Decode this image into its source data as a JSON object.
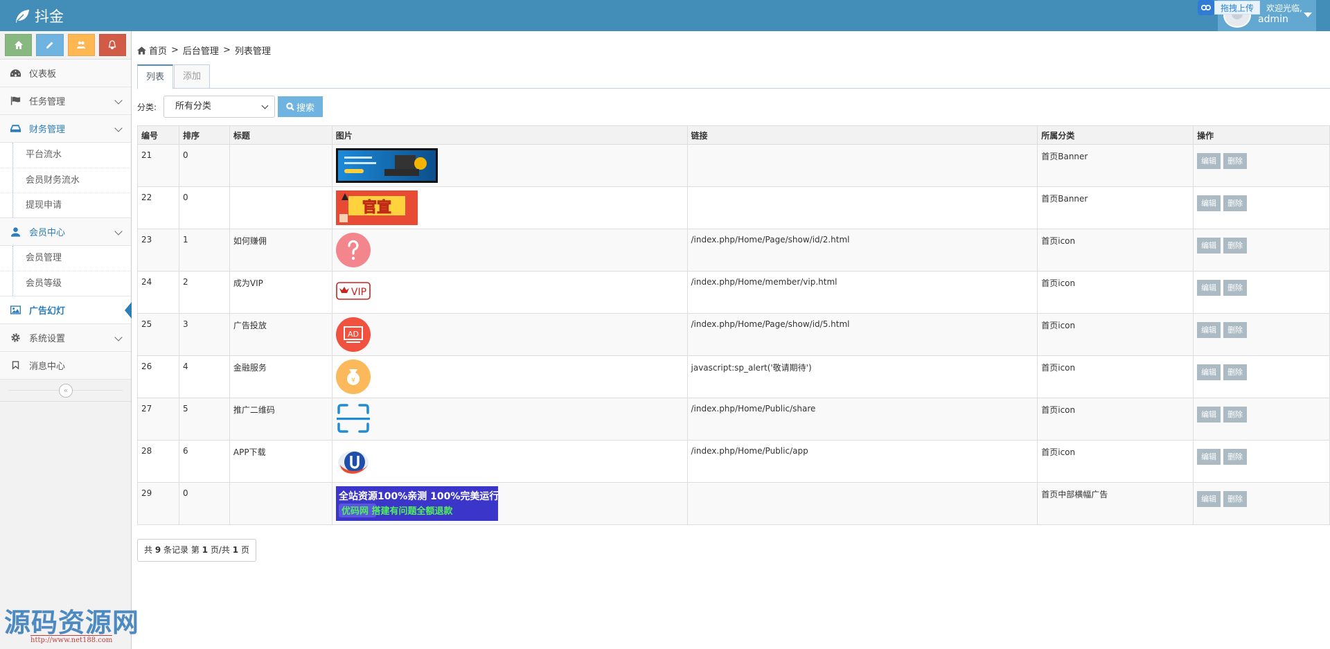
{
  "brand": {
    "name": "抖金"
  },
  "header": {
    "upload_label": "拖拽上传",
    "greeting": "欢迎光临,",
    "username": "admin"
  },
  "sidebar": {
    "shortcut_colors": [
      "#87b87f",
      "#6fb3e0",
      "#ffb752",
      "#d15b47"
    ],
    "items": [
      {
        "label": "仪表板",
        "icon": "dashboard-icon",
        "has_arrow": false
      },
      {
        "label": "任务管理",
        "icon": "flag-icon",
        "has_arrow": true
      },
      {
        "label": "财务管理",
        "icon": "drive-icon",
        "has_arrow": true,
        "open": true,
        "children": [
          "平台流水",
          "会员财务流水",
          "提现申请"
        ]
      },
      {
        "label": "会员中心",
        "icon": "user-icon",
        "has_arrow": true,
        "open": true,
        "children": [
          "会员管理",
          "会员等级"
        ]
      },
      {
        "label": "广告幻灯",
        "icon": "picture-icon",
        "has_arrow": false,
        "active": true
      },
      {
        "label": "系统设置",
        "icon": "gear-icon",
        "has_arrow": true
      },
      {
        "label": "消息中心",
        "icon": "bookmark-icon",
        "has_arrow": false
      }
    ]
  },
  "watermark": {
    "text": "源码资源网",
    "url": "http://www.net188.com"
  },
  "breadcrumb": [
    "首页",
    "后台管理",
    "列表管理"
  ],
  "tabs": [
    {
      "label": "列表",
      "active": true
    },
    {
      "label": "添加",
      "active": false
    }
  ],
  "filter": {
    "label": "分类:",
    "selected": "所有分类",
    "search_label": "搜索"
  },
  "table": {
    "headers": [
      "编号",
      "排序",
      "标题",
      "图片",
      "链接",
      "所属分类",
      "操作"
    ],
    "edit_label": "编辑",
    "delete_label": "删除",
    "rows": [
      {
        "id": "21",
        "sort": "0",
        "title": "",
        "image": "banner-blue",
        "link": "",
        "category": "首页Banner"
      },
      {
        "id": "22",
        "sort": "0",
        "title": "",
        "image": "banner-official",
        "link": "",
        "category": "首页Banner"
      },
      {
        "id": "23",
        "sort": "1",
        "title": "如何赚佣",
        "image": "icon-question",
        "link": "/index.php/Home/Page/show/id/2.html",
        "category": "首页icon"
      },
      {
        "id": "24",
        "sort": "2",
        "title": "成为VIP",
        "image": "icon-vip",
        "link": "/index.php/Home/member/vip.html",
        "category": "首页icon"
      },
      {
        "id": "25",
        "sort": "3",
        "title": "广告投放",
        "image": "icon-ad",
        "link": "/index.php/Home/Page/show/id/5.html",
        "category": "首页icon"
      },
      {
        "id": "26",
        "sort": "4",
        "title": "金融服务",
        "image": "icon-money",
        "link": "javascript:sp_alert('敬请期待')",
        "category": "首页icon"
      },
      {
        "id": "27",
        "sort": "5",
        "title": "推广二维码",
        "image": "icon-scan",
        "link": "/index.php/Home/Public/share",
        "category": "首页icon"
      },
      {
        "id": "28",
        "sort": "6",
        "title": "APP下载",
        "image": "icon-u",
        "link": "/index.php/Home/Public/app",
        "category": "首页icon"
      },
      {
        "id": "29",
        "sort": "0",
        "title": "",
        "image": "banner-youma",
        "link": "",
        "category": "首页中部横幅广告"
      }
    ]
  },
  "image_text": {
    "official": "官宣",
    "vip": "VIP",
    "ad": "AD",
    "banner_line1": "全站资源100%亲测 100%完美运行",
    "banner_line2": "优码网 搭建有问题全额退款"
  },
  "pager": {
    "prefix": "共",
    "total": "9",
    "mid1": "条记录 第",
    "page": "1",
    "mid2": "页/共",
    "pages": "1",
    "suffix": "页"
  }
}
